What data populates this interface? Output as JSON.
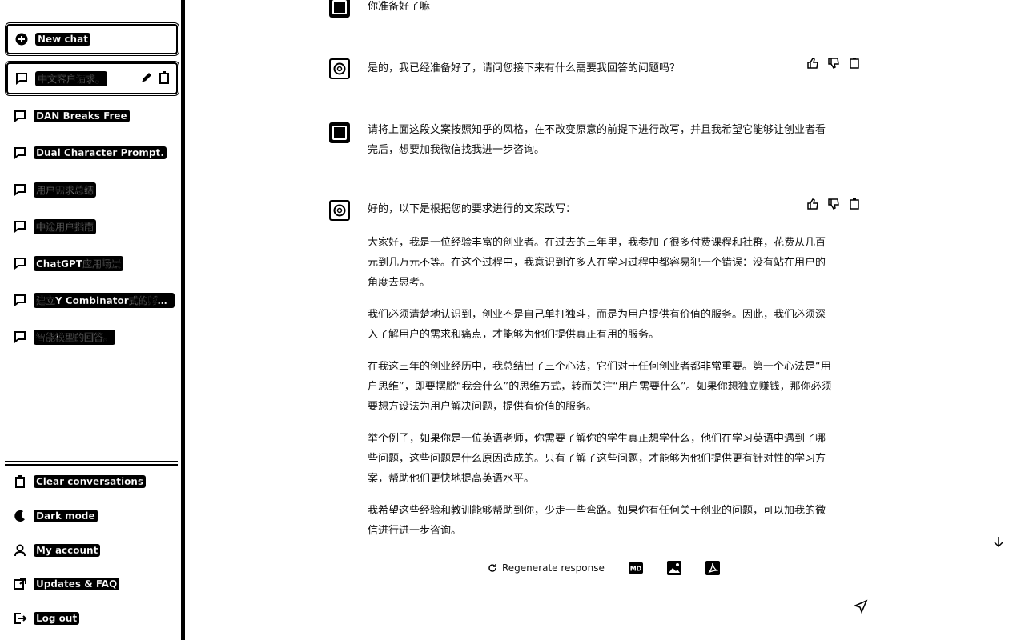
{
  "sidebar": {
    "new_chat": "New chat",
    "items": [
      {
        "label": "中文客户请求。",
        "icon": "chat-bubble-icon"
      },
      {
        "label": "DAN Breaks Free",
        "icon": "chat-bubble-icon"
      },
      {
        "label": "Dual Character Prompt.",
        "icon": "chat-bubble-icon"
      },
      {
        "label": "用户需求总结",
        "icon": "chat-bubble-icon"
      },
      {
        "label": "中途用户指南",
        "icon": "chat-bubble-icon"
      },
      {
        "label": "ChatGPT应用场景",
        "icon": "chat-bubble-icon"
      },
      {
        "label": "建立Y Combinator式的孵化器",
        "icon": "chat-bubble-icon"
      },
      {
        "label": "智能模型的回答。",
        "icon": "chat-bubble-icon"
      }
    ],
    "bottom": [
      {
        "label": "Clear conversations",
        "icon": "trash-icon"
      },
      {
        "label": "Dark mode",
        "icon": "moon-icon"
      },
      {
        "label": "My account",
        "icon": "user-icon"
      },
      {
        "label": "Updates & FAQ",
        "icon": "external-link-icon"
      },
      {
        "label": "Log out",
        "icon": "logout-icon"
      }
    ]
  },
  "conversation": {
    "user_1": "你准备好了嘛",
    "assistant_1": "是的，我已经准备好了，请问您接下来有什么需要我回答的问题吗？",
    "user_2": "请将上面这段文案按照知乎的风格，在不改变原意的前提下进行改写，并且我希望它能够让创业者看完后，想要加我微信找我进一步咨询。",
    "assistant_2": {
      "intro": "好的，以下是根据您的要求进行的文案改写：",
      "paragraphs": [
        "大家好，我是一位经验丰富的创业者。在过去的三年里，我参加了很多付费课程和社群，花费从几百元到几万元不等。在这个过程中，我意识到许多人在学习过程中都容易犯一个错误：没有站在用户的角度去思考。",
        "我们必须清楚地认识到，创业不是自己单打独斗，而是为用户提供有价值的服务。因此，我们必须深入了解用户的需求和痛点，才能够为他们提供真正有用的服务。",
        "在我这三年的创业经历中，我总结出了三个心法，它们对于任何创业者都非常重要。第一个心法是“用户思维”，即要摆脱“我会什么”的思维方式，转而关注“用户需要什么”。如果你想独立赚钱，那你必须要想方设法为用户解决问题，提供有价值的服务。",
        "举个例子，如果你是一位英语老师，你需要了解你的学生真正想学什么，他们在学习英语中遇到了哪些问题，这些问题是什么原因造成的。只有了解了这些问题，才能够为他们提供更有针对性的学习方案，帮助他们更快地提高英语水平。",
        "我希望这些经验和教训能够帮助到你，少走一些弯路。如果你有任何关于创业的问题，可以加我的微信进行进一步咨询。"
      ]
    }
  },
  "footer": {
    "regenerate": "Regenerate response",
    "md_label": "MD"
  }
}
